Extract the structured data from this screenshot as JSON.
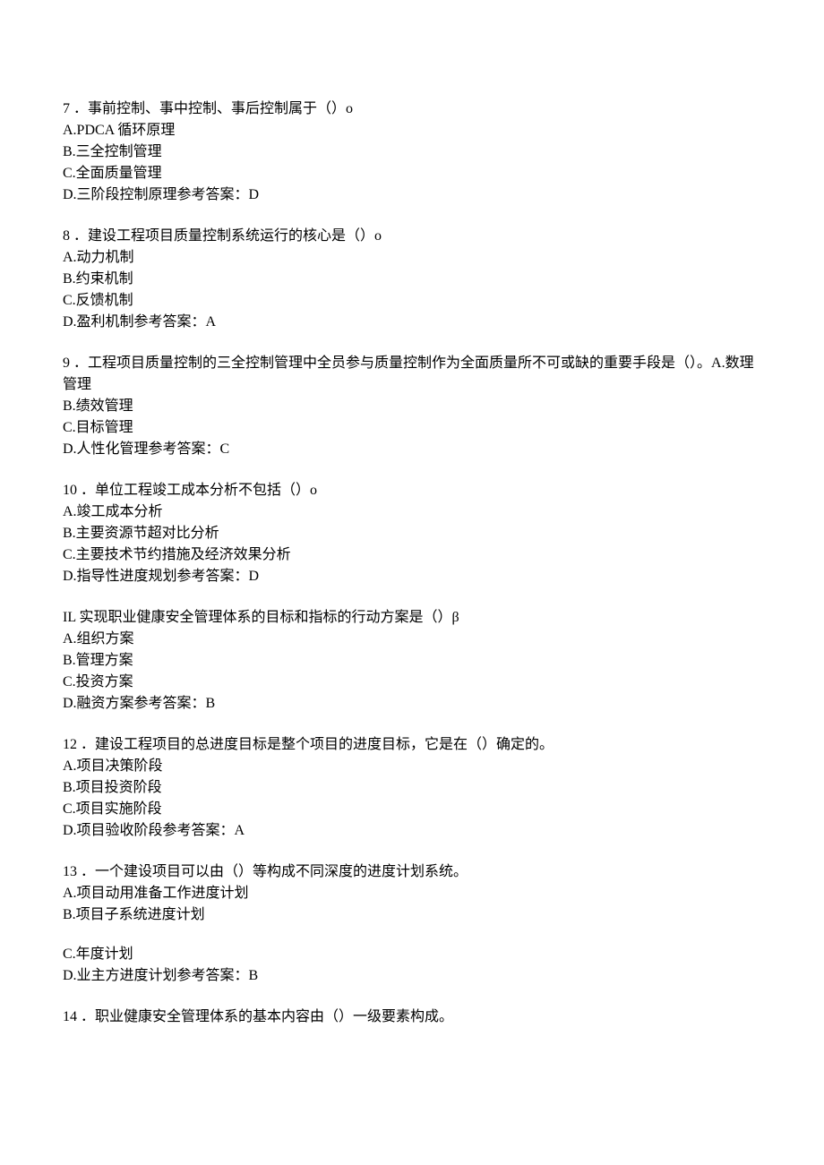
{
  "questions": [
    {
      "num": "7",
      "sep": " ．",
      "text": "事前控制、事中控制、事后控制属于（）o",
      "inline_opt": "",
      "opts": [
        "A.PDCA 循环原理",
        "B.三全控制管理",
        "C.全面质量管理",
        "D.三阶段控制原理参考答案：D"
      ]
    },
    {
      "num": "8",
      "sep": " ．",
      "text": "建设工程项目质量控制系统运行的核心是（）o",
      "inline_opt": "",
      "opts": [
        "A.动力机制",
        "B.约束机制",
        "C.反馈机制",
        "D.盈利机制参考答案：A"
      ]
    },
    {
      "num": "9",
      "sep": " ．",
      "text": "工程项目质量控制的三全控制管理中全员参与质量控制作为全面质量所不可或缺的重要手段是（）。",
      "inline_opt": "A.数理管理",
      "opts": [
        "B.绩效管理",
        "C.目标管理",
        "D.人性化管理参考答案：C"
      ]
    },
    {
      "num": "10",
      "sep": " ．",
      "text": "单位工程竣工成本分析不包括（）o",
      "inline_opt": "",
      "opts": [
        "A.竣工成本分析",
        "B.主要资源节超对比分析",
        "C.主要技术节约措施及经济效果分析",
        "D.指导性进度规划参考答案：D"
      ]
    },
    {
      "num": "IL",
      "sep": " ",
      "text": "实现职业健康安全管理体系的目标和指标的行动方案是（）β",
      "inline_opt": "",
      "opts": [
        "A.组织方案",
        "B.管理方案",
        "C.投资方案",
        "D.融资方案参考答案：B"
      ]
    },
    {
      "num": "12",
      "sep": " ．",
      "text": "建设工程项目的总进度目标是整个项目的进度目标，它是在（）确定的。",
      "inline_opt": "",
      "opts": [
        "A.项目决策阶段",
        "B.项目投资阶段",
        "C.项目实施阶段",
        "D.项目验收阶段参考答案：A"
      ]
    },
    {
      "num": "13",
      "sep": " ．",
      "text": "一个建设项目可以由（）等构成不同深度的进度计划系统。",
      "inline_opt": "",
      "opts": [
        "A.项目动用准备工作进度计划",
        "B.项目子系统进度计划"
      ],
      "opts2": [
        "C.年度计划",
        "D.业主方进度计划参考答案：B"
      ]
    },
    {
      "num": "14",
      "sep": " ．",
      "text": "职业健康安全管理体系的基本内容由（）一级要素构成。",
      "inline_opt": "",
      "opts": []
    }
  ]
}
